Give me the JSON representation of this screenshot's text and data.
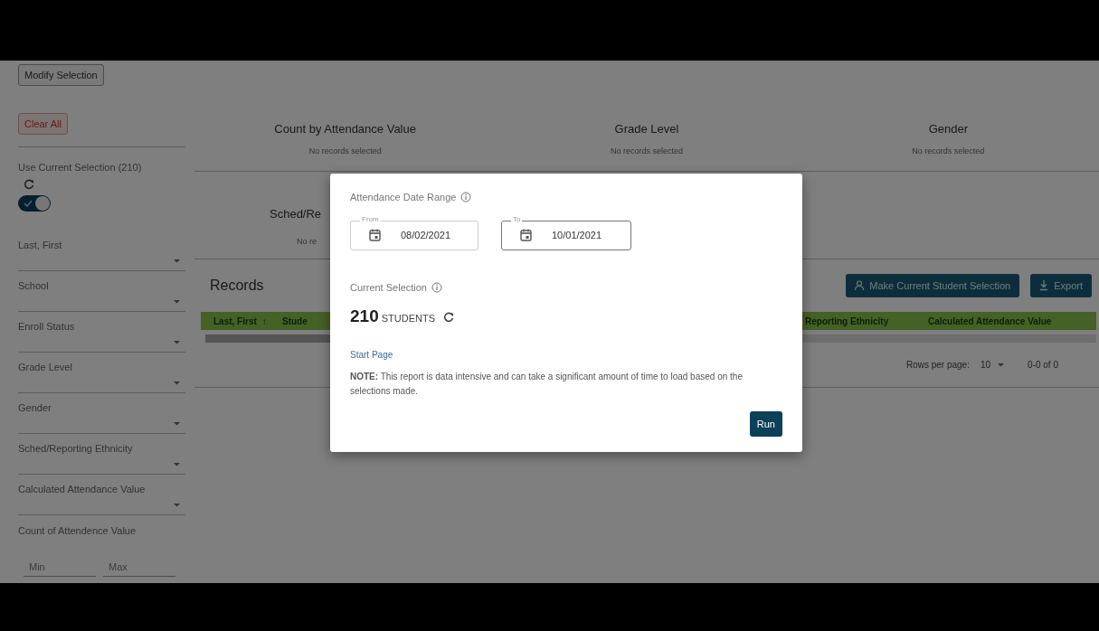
{
  "sidebar": {
    "modify_button": "Modify Selection",
    "clear_button": "Clear All",
    "use_current": {
      "label": "Use Current Selection (210)",
      "on": true
    },
    "filters": [
      {
        "label": "Last, First"
      },
      {
        "label": "School"
      },
      {
        "label": "Enroll Status"
      },
      {
        "label": "Grade Level"
      },
      {
        "label": "Gender"
      },
      {
        "label": "Sched/Reporting Ethnicity"
      },
      {
        "label": "Calculated Attendance Value"
      }
    ],
    "count_filter": {
      "label": "Count of Attendence Value",
      "min_placeholder": "Min",
      "max_placeholder": "Max"
    }
  },
  "charts": [
    {
      "title": "Count by Attendance Value",
      "message": "No records selected"
    },
    {
      "title": "Grade Level",
      "message": "No records selected"
    },
    {
      "title": "Gender",
      "message": "No records selected"
    },
    {
      "title": "Sched/Re",
      "message": "No re"
    }
  ],
  "records": {
    "title": "Records",
    "buttons": [
      {
        "label": "Make Current Student Selection"
      },
      {
        "label": "Export"
      }
    ],
    "columns": [
      {
        "label": "Last, First",
        "sort": "↑"
      },
      {
        "label": "Stude"
      },
      {
        "label": "Reporting Ethnicity"
      },
      {
        "label": "Calculated Attendance Value"
      }
    ],
    "rows_per_page_label": "Rows per page:",
    "rows_per_page": "10",
    "range": "0-0 of 0"
  },
  "dialog": {
    "date_range_title": "Attendance Date Range",
    "from": {
      "label": "From",
      "value": "08/02/2021",
      "focused": false
    },
    "to": {
      "label": "To",
      "value": "10/01/2021",
      "focused": true
    },
    "selection_title": "Current Selection",
    "count": "210",
    "unit": "STUDENTS",
    "link": "Start Page",
    "note": "**NOTE:** This report is data intensive and can take a significant amount of time to load based on the selections made.",
    "run_button": "Run"
  }
}
